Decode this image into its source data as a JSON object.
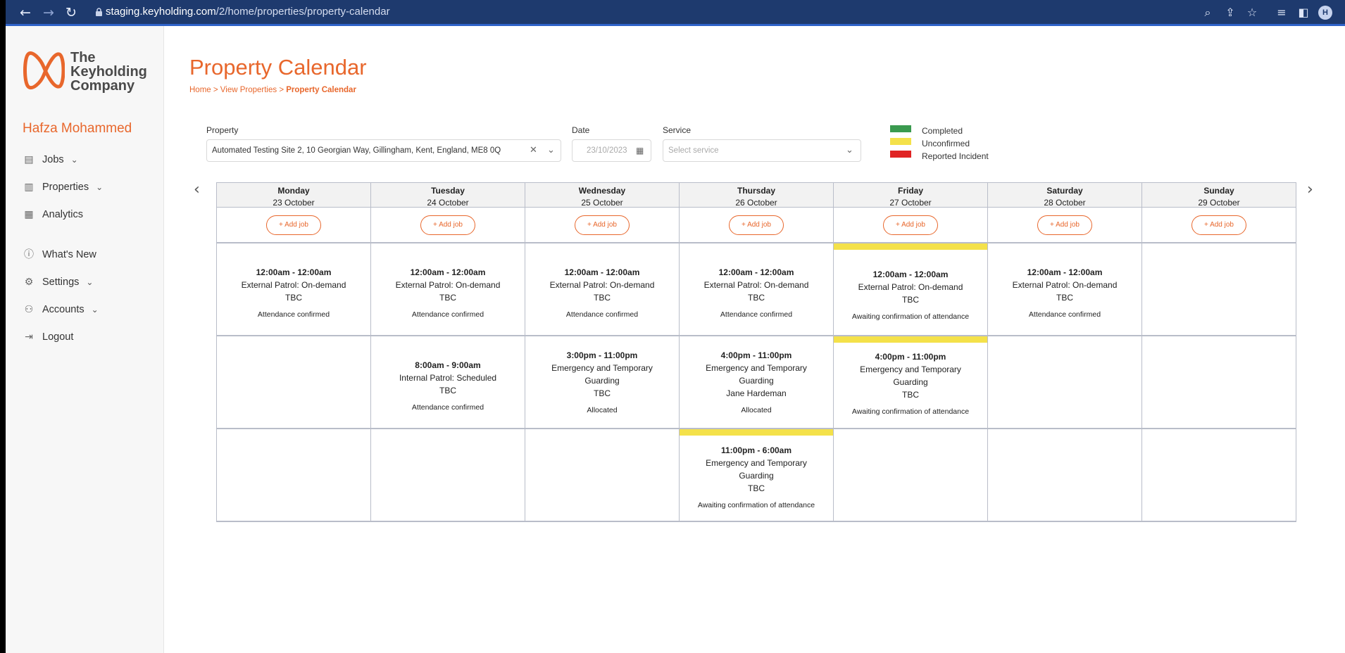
{
  "browser": {
    "url_host": "staging.keyholding.com",
    "url_path": "/2/home/properties/property-calendar",
    "avatar_initial": "H"
  },
  "sidebar": {
    "logo_text": [
      "The",
      "Keyholding",
      "Company"
    ],
    "user_name": "Hafza Mohammed",
    "items": [
      {
        "label": "Jobs",
        "icon": "jobs-icon",
        "has_chevron": true
      },
      {
        "label": "Properties",
        "icon": "building-icon",
        "has_chevron": true
      },
      {
        "label": "Analytics",
        "icon": "chart-icon",
        "has_chevron": false
      },
      {
        "label": "What's New",
        "icon": "info-icon",
        "has_chevron": false
      },
      {
        "label": "Settings",
        "icon": "gear-icon",
        "has_chevron": true
      },
      {
        "label": "Accounts",
        "icon": "users-icon",
        "has_chevron": true
      },
      {
        "label": "Logout",
        "icon": "logout-icon",
        "has_chevron": false
      }
    ]
  },
  "page": {
    "title": "Property Calendar",
    "breadcrumb": {
      "home": "Home",
      "sep1": " > ",
      "view": "View Properties",
      "sep2": " > ",
      "current": "Property Calendar"
    }
  },
  "filters": {
    "property_label": "Property",
    "property_value": "Automated Testing Site 2, 10 Georgian Way, Gillingham, Kent, England, ME8 0Q",
    "date_label": "Date",
    "date_placeholder": "23/10/2023",
    "service_label": "Service",
    "service_placeholder": "Select service"
  },
  "legend": [
    {
      "label": "Completed",
      "color": "#3a9a4f"
    },
    {
      "label": "Unconfirmed",
      "color": "#f4e14a"
    },
    {
      "label": "Reported Incident",
      "color": "#e02424"
    }
  ],
  "calendar": {
    "add_job_label": "+ Add job",
    "days": [
      {
        "name": "Monday",
        "date": "23 October"
      },
      {
        "name": "Tuesday",
        "date": "24 October"
      },
      {
        "name": "Wednesday",
        "date": "25 October"
      },
      {
        "name": "Thursday",
        "date": "26 October"
      },
      {
        "name": "Friday",
        "date": "27 October"
      },
      {
        "name": "Saturday",
        "date": "28 October"
      },
      {
        "name": "Sunday",
        "date": "29 October"
      }
    ],
    "jobs": {
      "mon_r1": {
        "time": "12:00am - 12:00am",
        "service": "External Patrol: On-demand",
        "assignee": "TBC",
        "status": "Attendance confirmed"
      },
      "tue_r1": {
        "time": "12:00am - 12:00am",
        "service": "External Patrol: On-demand",
        "assignee": "TBC",
        "status": "Attendance confirmed"
      },
      "wed_r1": {
        "time": "12:00am - 12:00am",
        "service": "External Patrol: On-demand",
        "assignee": "TBC",
        "status": "Attendance confirmed"
      },
      "thu_r1": {
        "time": "12:00am - 12:00am",
        "service": "External Patrol: On-demand",
        "assignee": "TBC",
        "status": "Attendance confirmed"
      },
      "fri_r1": {
        "time": "12:00am - 12:00am",
        "service": "External Patrol: On-demand",
        "assignee": "TBC",
        "status": "Awaiting confirmation of attendance",
        "unconfirmed": true
      },
      "sat_r1": {
        "time": "12:00am - 12:00am",
        "service": "External Patrol: On-demand",
        "assignee": "TBC",
        "status": "Attendance confirmed"
      },
      "tue_r2": {
        "time": "8:00am - 9:00am",
        "service": "Internal Patrol: Scheduled",
        "assignee": "TBC",
        "status": "Attendance confirmed"
      },
      "wed_r2": {
        "time": "3:00pm - 11:00pm",
        "service_line1": "Emergency and Temporary",
        "service_line2": "Guarding",
        "assignee": "TBC",
        "status": "Allocated"
      },
      "thu_r2": {
        "time": "4:00pm - 11:00pm",
        "service_line1": "Emergency and Temporary",
        "service_line2": "Guarding",
        "assignee": "Jane Hardeman",
        "status": "Allocated"
      },
      "fri_r2": {
        "time": "4:00pm - 11:00pm",
        "service_line1": "Emergency and Temporary",
        "service_line2": "Guarding",
        "assignee": "TBC",
        "status": "Awaiting confirmation of attendance",
        "unconfirmed": true
      },
      "thu_r3": {
        "time": "11:00pm - 6:00am",
        "service_line1": "Emergency and Temporary",
        "service_line2": "Guarding",
        "assignee": "TBC",
        "status": "Awaiting confirmation of attendance",
        "unconfirmed": true
      }
    }
  }
}
